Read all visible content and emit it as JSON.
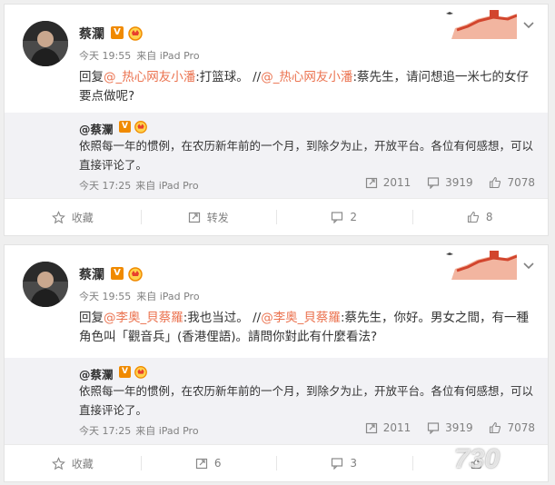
{
  "posts": [
    {
      "user": {
        "name": "蔡瀾",
        "badge": "V"
      },
      "meta": {
        "time": "今天 19:55",
        "source": "来自 iPad Pro"
      },
      "content": {
        "prefix": "回复",
        "mention1": "@_热心网友小潘",
        "reply": ":打篮球。 //",
        "mention2": "@_热心网友小潘",
        "rest": ":蔡先生，请问想追一米七的女仔 要点做呢?"
      },
      "quote": {
        "user": "@蔡瀾",
        "badge": "V",
        "text": "依照每一年的惯例，在农历新年前的一个月，到除夕为止，开放平台。各位有何感想，可以直接评论了。",
        "time": "今天 17:25",
        "source": "来自 iPad Pro",
        "reposts": "2011",
        "comments": "3919",
        "likes": "7078"
      },
      "actions": {
        "favorite": "收藏",
        "repost": "转发",
        "comment": "2",
        "like": "8"
      }
    },
    {
      "user": {
        "name": "蔡瀾",
        "badge": "V"
      },
      "meta": {
        "time": "今天 19:55",
        "source": "来自 iPad Pro"
      },
      "content": {
        "prefix": "回复",
        "mention1": "@李奥_貝蔡羅",
        "reply": ":我也当过。 //",
        "mention2": "@李奥_貝蔡羅",
        "rest": ":蔡先生，你好。男女之間，有一種角色叫「觀音兵」(香港俚語)。請問你對此有什麼看法?"
      },
      "quote": {
        "user": "@蔡瀾",
        "badge": "V",
        "text": "依照每一年的惯例，在农历新年前的一个月，到除夕为止，开放平台。各位有何感想，可以直接评论了。",
        "time": "今天 17:25",
        "source": "来自 iPad Pro",
        "reposts": "2011",
        "comments": "3919",
        "likes": "7078"
      },
      "actions": {
        "favorite": "收藏",
        "repost": "6",
        "comment": "3",
        "like": ""
      }
    }
  ],
  "watermark": "730",
  "colors": {
    "link": "#eb7350",
    "vip": "#f08a00",
    "meta": "#808080",
    "quote_bg": "#f2f2f5"
  }
}
